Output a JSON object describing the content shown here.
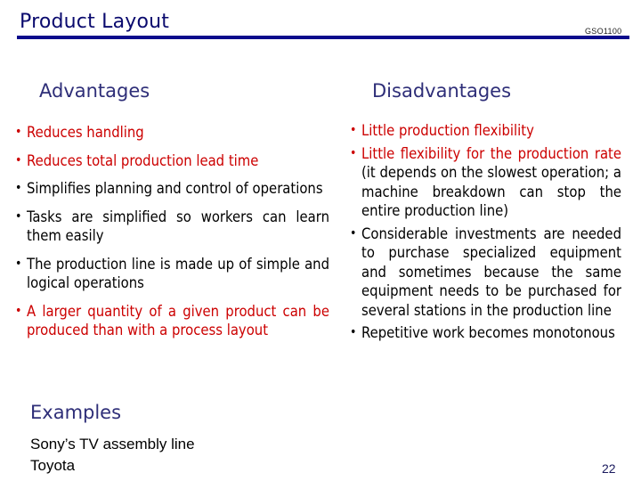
{
  "slide": {
    "title": "Product Layout",
    "course_code": "GSO1100",
    "page_number": "22"
  },
  "advantages": {
    "heading": "Advantages",
    "items": [
      {
        "text": "Reduces handling",
        "highlight": true
      },
      {
        "text": "Reduces total production lead time",
        "highlight": true
      },
      {
        "text": "Simplifies planning and control of operations",
        "highlight": false
      },
      {
        "text": "Tasks are simplified so workers can learn them easily",
        "highlight": false
      },
      {
        "text": "The production line is made up of simple and logical operations",
        "highlight": false
      },
      {
        "text": "A larger quantity of a given product can be produced than with a process layout",
        "highlight": true
      }
    ]
  },
  "disadvantages": {
    "heading": "Disadvantages",
    "items": [
      {
        "text": "Little production flexibility",
        "highlight": true
      },
      {
        "text_red": "Little flexibility for the production rate",
        "text": " (it depends on the slowest operation; a machine breakdown can stop the entire production line)"
      },
      {
        "text": "Considerable investments are needed to purchase specialized equipment and sometimes because the same equipment needs to be purchased for several stations in the production line",
        "highlight": false
      },
      {
        "text": "Repetitive work becomes monotonous",
        "highlight": false
      }
    ]
  },
  "examples": {
    "heading": "Examples",
    "items": [
      "Sony’s TV assembly line",
      "Toyota"
    ]
  },
  "colors": {
    "title": "#0a0a6e",
    "heading": "#2e2e78",
    "highlight": "#cc0000",
    "rule": "#0a0a8c"
  }
}
